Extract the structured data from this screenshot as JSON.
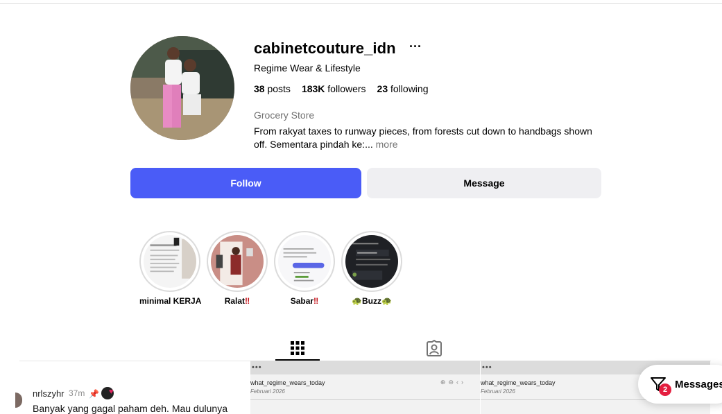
{
  "profile": {
    "username": "cabinetcouture_idn",
    "more_menu": "···",
    "full_name": "Regime Wear & Lifestyle",
    "posts_count": "38",
    "posts_label": "posts",
    "followers_count": "183K",
    "followers_label": "followers",
    "following_count": "23",
    "following_label": "following",
    "category": "Grocery Store",
    "bio": "From rakyat taxes to runway pieces, from forests cut down to handbags shown off. Sementara pindah ke:...",
    "bio_more": "more"
  },
  "actions": {
    "follow_label": "Follow",
    "message_label": "Message"
  },
  "highlights": [
    {
      "label": "minimal KERJA",
      "emoji": ""
    },
    {
      "label": "Ralat",
      "emoji": "‼"
    },
    {
      "label": "Sabar",
      "emoji": "‼"
    },
    {
      "label": "Buzz",
      "emoji_left": "🐢",
      "emoji_right": "🐢"
    }
  ],
  "tabs": [
    {
      "name": "posts-grid",
      "icon": "grid-icon",
      "active": true
    },
    {
      "name": "tagged",
      "icon": "tagged-person-icon",
      "active": false
    }
  ],
  "comment": {
    "user": "nrlszyhr",
    "time": "37m",
    "text": "Banyak yang gagal paham deh. Mau dulunya"
  },
  "posts": [
    {
      "dots": "•••",
      "account": "what_regime_wears_today",
      "date": "Februari 2026"
    },
    {
      "dots": "•••",
      "account": "what_regime_wears_today",
      "date": "Februari 2026"
    }
  ],
  "messages": {
    "label": "Messages",
    "badge": "2",
    "icon": "messages-icon"
  },
  "colors": {
    "follow_button": "#4a5cf7",
    "message_button": "#efeff2",
    "badge": "#e41e3f",
    "secondary_text": "#737373"
  }
}
